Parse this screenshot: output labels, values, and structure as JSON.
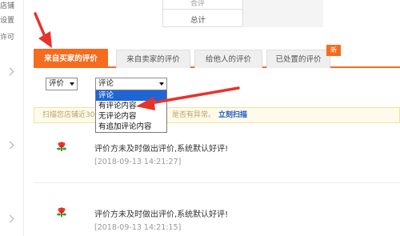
{
  "sidebar": {
    "items": [
      {
        "label": "店铺",
        "has_arrow": false
      },
      {
        "label": "设置",
        "has_arrow": false
      },
      {
        "label": "许可",
        "has_arrow": false
      }
    ]
  },
  "summary": {
    "ghost_label": "合评",
    "total_label": "总计"
  },
  "tabs": [
    {
      "label": "来自买家的评价",
      "active": true
    },
    {
      "label": "来自卖家的评价",
      "active": false
    },
    {
      "label": "给他人的评价",
      "active": false
    },
    {
      "label": "已处置的评价",
      "active": false
    }
  ],
  "new_badge": "新",
  "filters": {
    "rating_select": {
      "value": "评价"
    },
    "comment_select": {
      "value": "评论"
    }
  },
  "dropdown": {
    "options": [
      "评论",
      "有评论内容",
      "无评论内容",
      "有追加评论内容"
    ],
    "selected": "评论"
  },
  "notice": {
    "text_left": "扫描您店铺近30",
    "text_right": "是否有异常。",
    "link": "立刻扫描"
  },
  "feedback": [
    {
      "text": "评价方未及时做出评价,系统默认好评!",
      "time": "[2018-09-13 14:21:27]"
    },
    {
      "text": "评价方未及时做出评价,系统默认好评!",
      "time": "[2018-09-13 14:21:15]"
    }
  ],
  "colors": {
    "accent": "#f56c1e",
    "link": "#1858c5",
    "selected_option": "#1e66d6",
    "annotation_arrow": "#e8322a"
  }
}
